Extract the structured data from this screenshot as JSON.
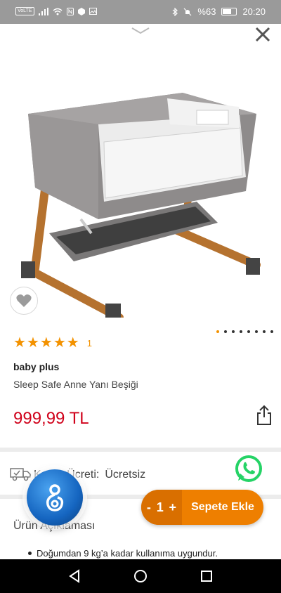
{
  "status_bar": {
    "volte": "VoLTE",
    "battery": "%63",
    "time": "20:20"
  },
  "product": {
    "rating_count": "1",
    "brand": "baby plus",
    "name": "Sleep Safe Anne Yanı Beşiği",
    "price": "999,99 TL"
  },
  "gallery": {
    "total_images": 8,
    "active_index": 0
  },
  "shipping": {
    "label": "Kargo Ücreti:",
    "value": "Ücretsiz"
  },
  "description": {
    "title": "Ürün Açıklaması",
    "items": [
      "Doğumdan 9 kg’a kadar kullanıma uygundur."
    ]
  },
  "cart": {
    "minus": "-",
    "quantity": "1",
    "plus": "+",
    "add_label": "Sepete Ekle"
  },
  "colors": {
    "accent": "#ee7f00",
    "price": "#d0021b",
    "star": "#f39200",
    "whatsapp": "#25d366"
  }
}
